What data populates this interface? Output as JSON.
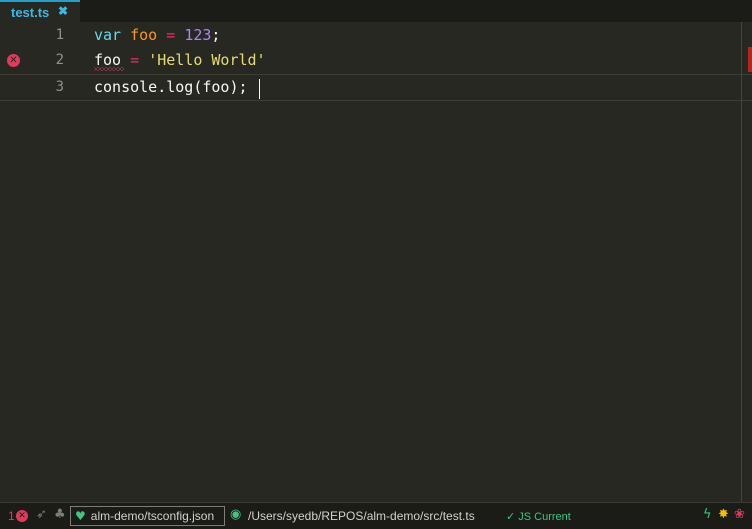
{
  "tab": {
    "title": "test.ts",
    "close_icon": "close-icon"
  },
  "editor": {
    "lines": [
      {
        "number": "1"
      },
      {
        "number": "2"
      },
      {
        "number": "3"
      }
    ],
    "code": {
      "l1_kw": "var",
      "l1_sp1": " ",
      "l1_var": "foo",
      "l1_sp2": " ",
      "l1_op": "=",
      "l1_sp3": " ",
      "l1_num": "123",
      "l1_end": ";",
      "l2_var": "foo",
      "l2_sp1": " ",
      "l2_op": "=",
      "l2_sp2": " ",
      "l2_str": "'Hello World'",
      "l3_text": "console.log(foo);"
    },
    "error_line": 2
  },
  "status": {
    "error_count": "1",
    "project": "alm-demo/tsconfig.json",
    "file_path": "/Users/syedb/REPOS/alm-demo/src/test.ts",
    "js_status": "✓ JS Current"
  },
  "colors": {
    "background": "#272822",
    "accent": "#1fa0c9",
    "error": "#e03a5e",
    "success": "#3bc77f"
  }
}
